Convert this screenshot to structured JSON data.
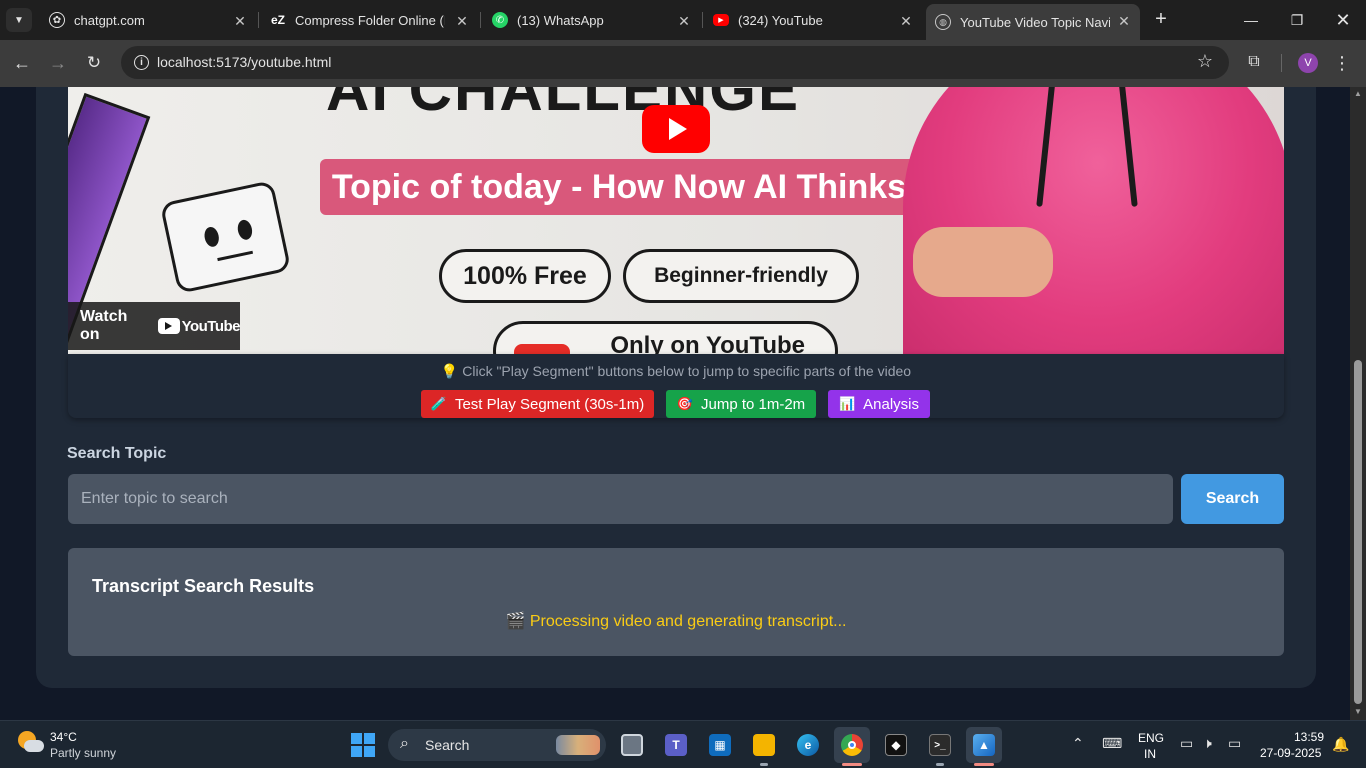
{
  "browser": {
    "tabs": [
      {
        "title": "chatgpt.com",
        "icon": "chatgpt-icon"
      },
      {
        "title": "Compress Folder Online (No",
        "icon": "ezyzip-icon",
        "favicon_text": "eZ"
      },
      {
        "title": "(13) WhatsApp",
        "icon": "whatsapp-icon"
      },
      {
        "title": "(324) YouTube",
        "icon": "youtube-icon"
      },
      {
        "title": "YouTube Video Topic Naviga",
        "icon": "globe-icon",
        "active": true
      }
    ],
    "new_tab_label": "+",
    "url": "localhost:5173/youtube.html",
    "profile_initial": "V"
  },
  "video": {
    "thumbnail_title": "AI CHALLENGE",
    "thumbnail_topic": "Topic of today - How Now AI Thinks",
    "thumbnail_pill_free": "100% Free",
    "thumbnail_pill_beginner": "Beginner-friendly",
    "thumbnail_pill_youtube": "Only on YouTube",
    "watch_on_label": "Watch on",
    "youtube_logo_text": "YouTube"
  },
  "segments": {
    "hint": "💡 Click \"Play Segment\" buttons below to jump to specific parts of the video",
    "buttons": [
      {
        "emoji": "🧪",
        "label": "Test Play Segment (30s-1m)",
        "color": "#dc2626"
      },
      {
        "emoji": "🎯",
        "label": "Jump to 1m-2m",
        "color": "#16a34a"
      },
      {
        "emoji": "📊",
        "label": "Analysis",
        "color": "#9333ea"
      }
    ]
  },
  "search": {
    "label": "Search Topic",
    "placeholder": "Enter topic to search",
    "value": "",
    "button_label": "Search"
  },
  "results": {
    "title": "Transcript Search Results",
    "status": "🎬 Processing video and generating transcript..."
  },
  "taskbar": {
    "weather_temp": "34°C",
    "weather_condition": "Partly sunny",
    "search_label": "Search",
    "language_line1": "ENG",
    "language_line2": "IN",
    "time": "13:59",
    "date": "27-09-2025"
  },
  "colors": {
    "page_bg": "#111827",
    "card_bg": "#1f2937",
    "input_bg": "#4b5563",
    "search_button": "#4299e1",
    "status_text": "#facc15",
    "youtube_red": "#ff0000"
  }
}
